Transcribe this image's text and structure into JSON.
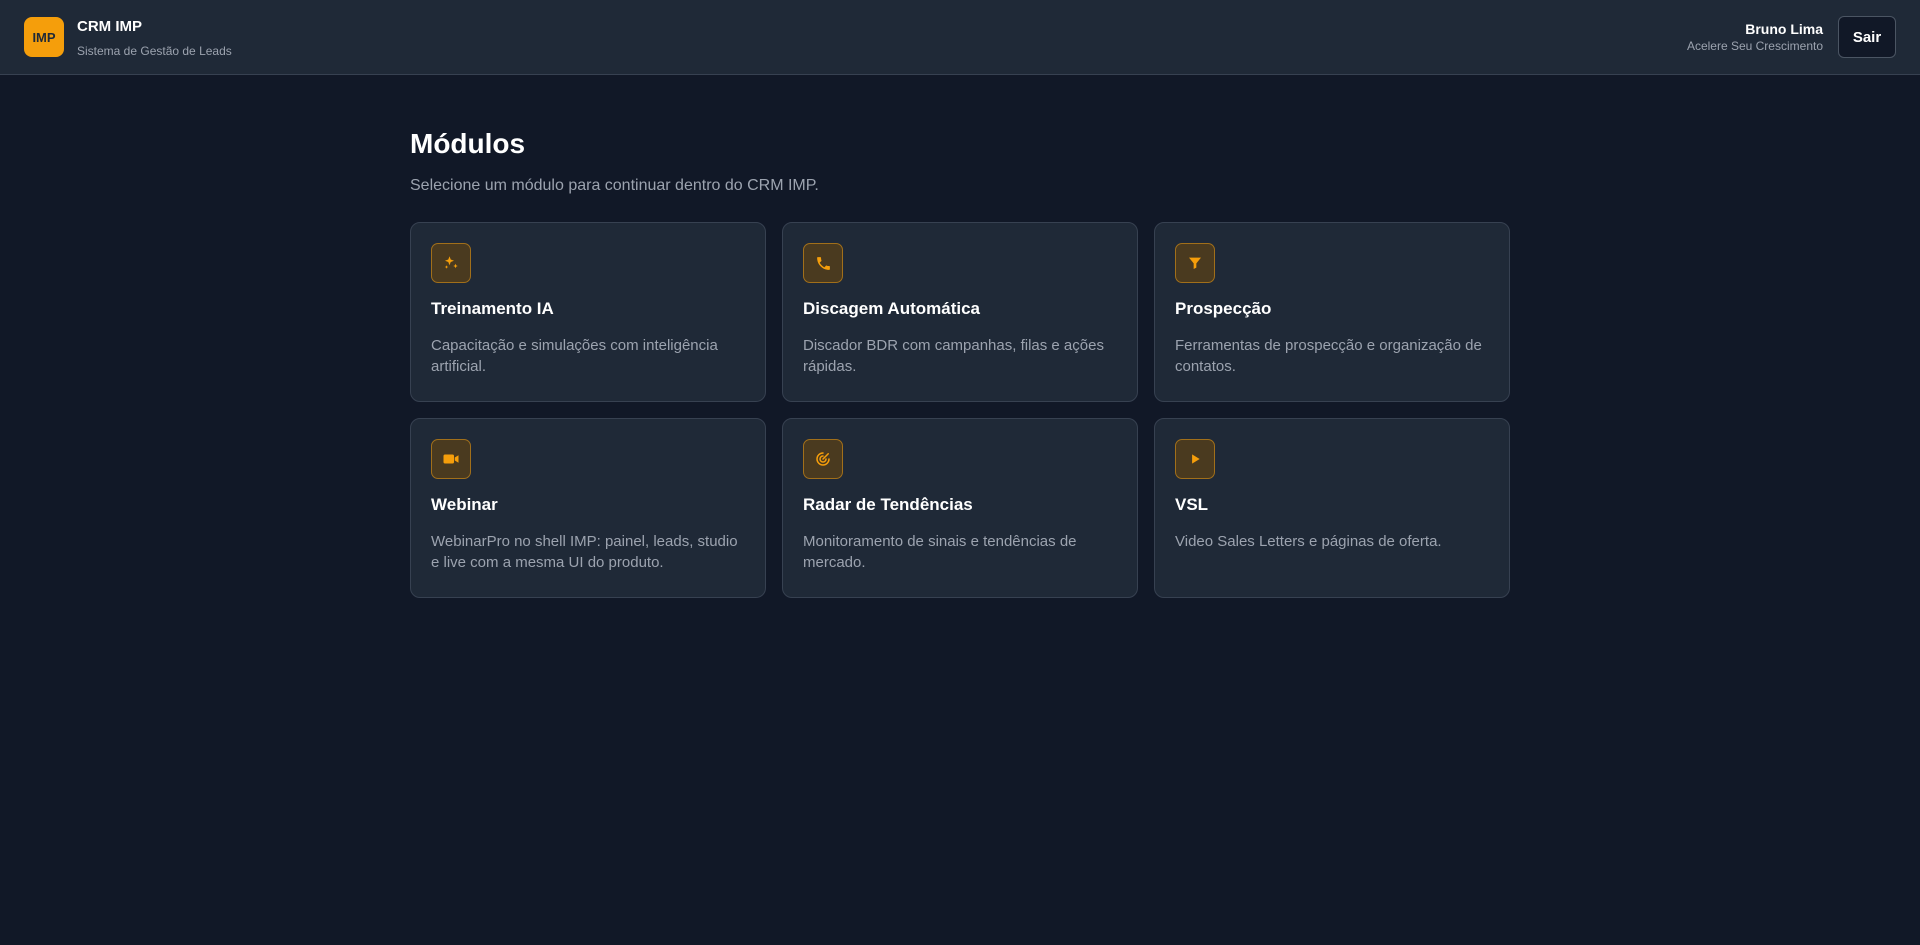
{
  "header": {
    "logo_text": "IMP",
    "title": "CRM IMP",
    "subtitle": "Sistema de Gestão de Leads",
    "user_name": "Bruno Lima",
    "user_tagline": "Acelere Seu Crescimento",
    "logout_label": "Sair"
  },
  "main": {
    "title": "Módulos",
    "subtitle": "Selecione um módulo para continuar dentro do CRM IMP."
  },
  "modules": [
    {
      "icon": "sparkles-icon",
      "title": "Treinamento IA",
      "description": "Capacitação e simulações com inteligência artificial."
    },
    {
      "icon": "phone-icon",
      "title": "Discagem Automática",
      "description": "Discador BDR com campanhas, filas e ações rápidas."
    },
    {
      "icon": "filter-icon",
      "title": "Prospecção",
      "description": "Ferramentas de prospecção e organização de contatos."
    },
    {
      "icon": "video-camera-icon",
      "title": "Webinar",
      "description": "WebinarPro no shell IMP: painel, leads, studio e live com a mesma UI do produto."
    },
    {
      "icon": "radar-icon",
      "title": "Radar de Tendências",
      "description": "Monitoramento de sinais e tendências de mercado."
    },
    {
      "icon": "play-icon",
      "title": "VSL",
      "description": "Video Sales Letters e páginas de oferta."
    }
  ],
  "colors": {
    "background": "#111827",
    "surface": "#1f2937",
    "accent": "#f59e0b",
    "border": "#374151"
  }
}
